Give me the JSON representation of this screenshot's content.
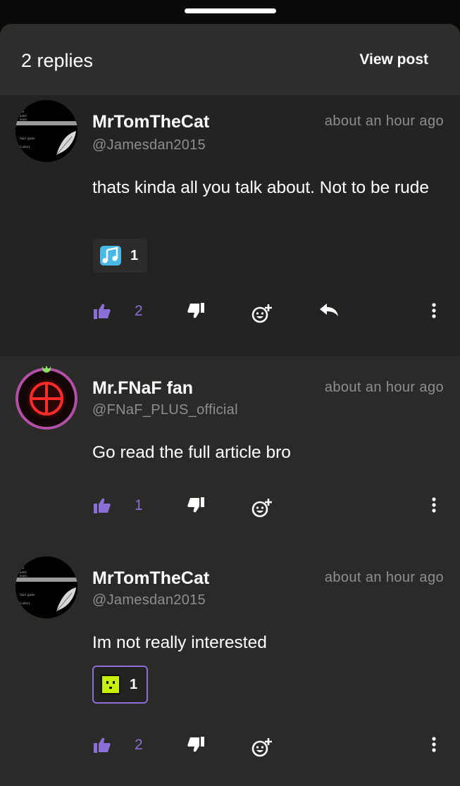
{
  "sheet": {
    "replies_count": "2 replies",
    "view_post_label": "View post"
  },
  "colors": {
    "accent": "#8a6fd6",
    "muted_text": "#8e8e8a",
    "sheet_bg": "#2a2a28"
  },
  "replies": [
    {
      "author": "MrTomTheCat",
      "handle": "@Jamesdan2015",
      "time": "about an hour ago",
      "text": "thats kinda all you talk about. Not to be rude",
      "reaction": {
        "icon": "music-notes-emoji-icon",
        "count": "1"
      },
      "likes": "2"
    },
    {
      "author": "Mr.FNaF fan",
      "handle": "@FNaF_PLUS_official",
      "time": "about an hour ago",
      "text": "Go read the full article bro",
      "likes": "1"
    },
    {
      "author": "MrTomTheCat",
      "handle": "@Jamesdan2015",
      "time": "about an hour ago",
      "text": "Im not really interested",
      "reaction": {
        "icon": "green-face-emoji-icon",
        "count": "1"
      },
      "likes": "2"
    }
  ]
}
